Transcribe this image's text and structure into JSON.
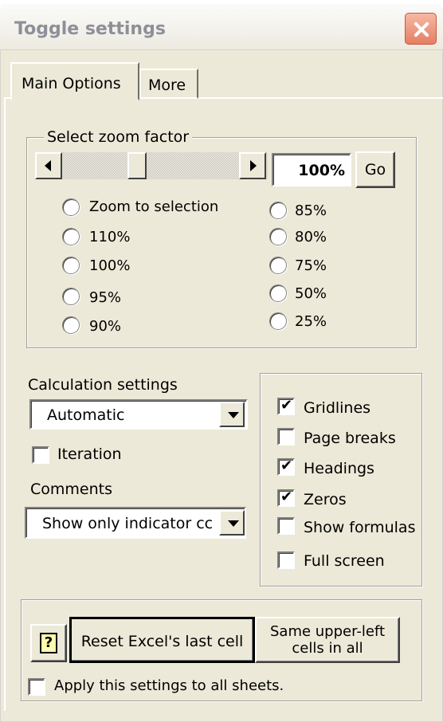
{
  "window": {
    "title": "Toggle settings"
  },
  "tabs": [
    {
      "label": "Main Options"
    },
    {
      "label": "More"
    }
  ],
  "zoom": {
    "legend": "Select zoom factor",
    "value": "100%",
    "go_label": "Go",
    "options_left": [
      "Zoom to selection",
      "110%",
      "100%",
      "95%",
      "90%"
    ],
    "options_right": [
      "85%",
      "80%",
      "75%",
      "50%",
      "25%"
    ]
  },
  "calculation": {
    "label": "Calculation settings",
    "selected": "Automatic",
    "iteration_label": "Iteration",
    "iteration_checked": false
  },
  "comments": {
    "label": "Comments",
    "selected": "Show only indicator cc"
  },
  "view_options": [
    {
      "label": "Gridlines",
      "checked": true
    },
    {
      "label": "Page breaks",
      "checked": false
    },
    {
      "label": "Headings",
      "checked": true
    },
    {
      "label": "Zeros",
      "checked": true
    },
    {
      "label": "Show formulas",
      "checked": false
    },
    {
      "label": "Full screen",
      "checked": false
    }
  ],
  "actions": {
    "help_icon": "question-mark-icon",
    "reset_label": "Reset Excel's last cell",
    "same_label_line1": "Same upper-left",
    "same_label_line2": "cells in all",
    "apply_all_label": "Apply this settings to all sheets.",
    "apply_all_checked": false
  }
}
